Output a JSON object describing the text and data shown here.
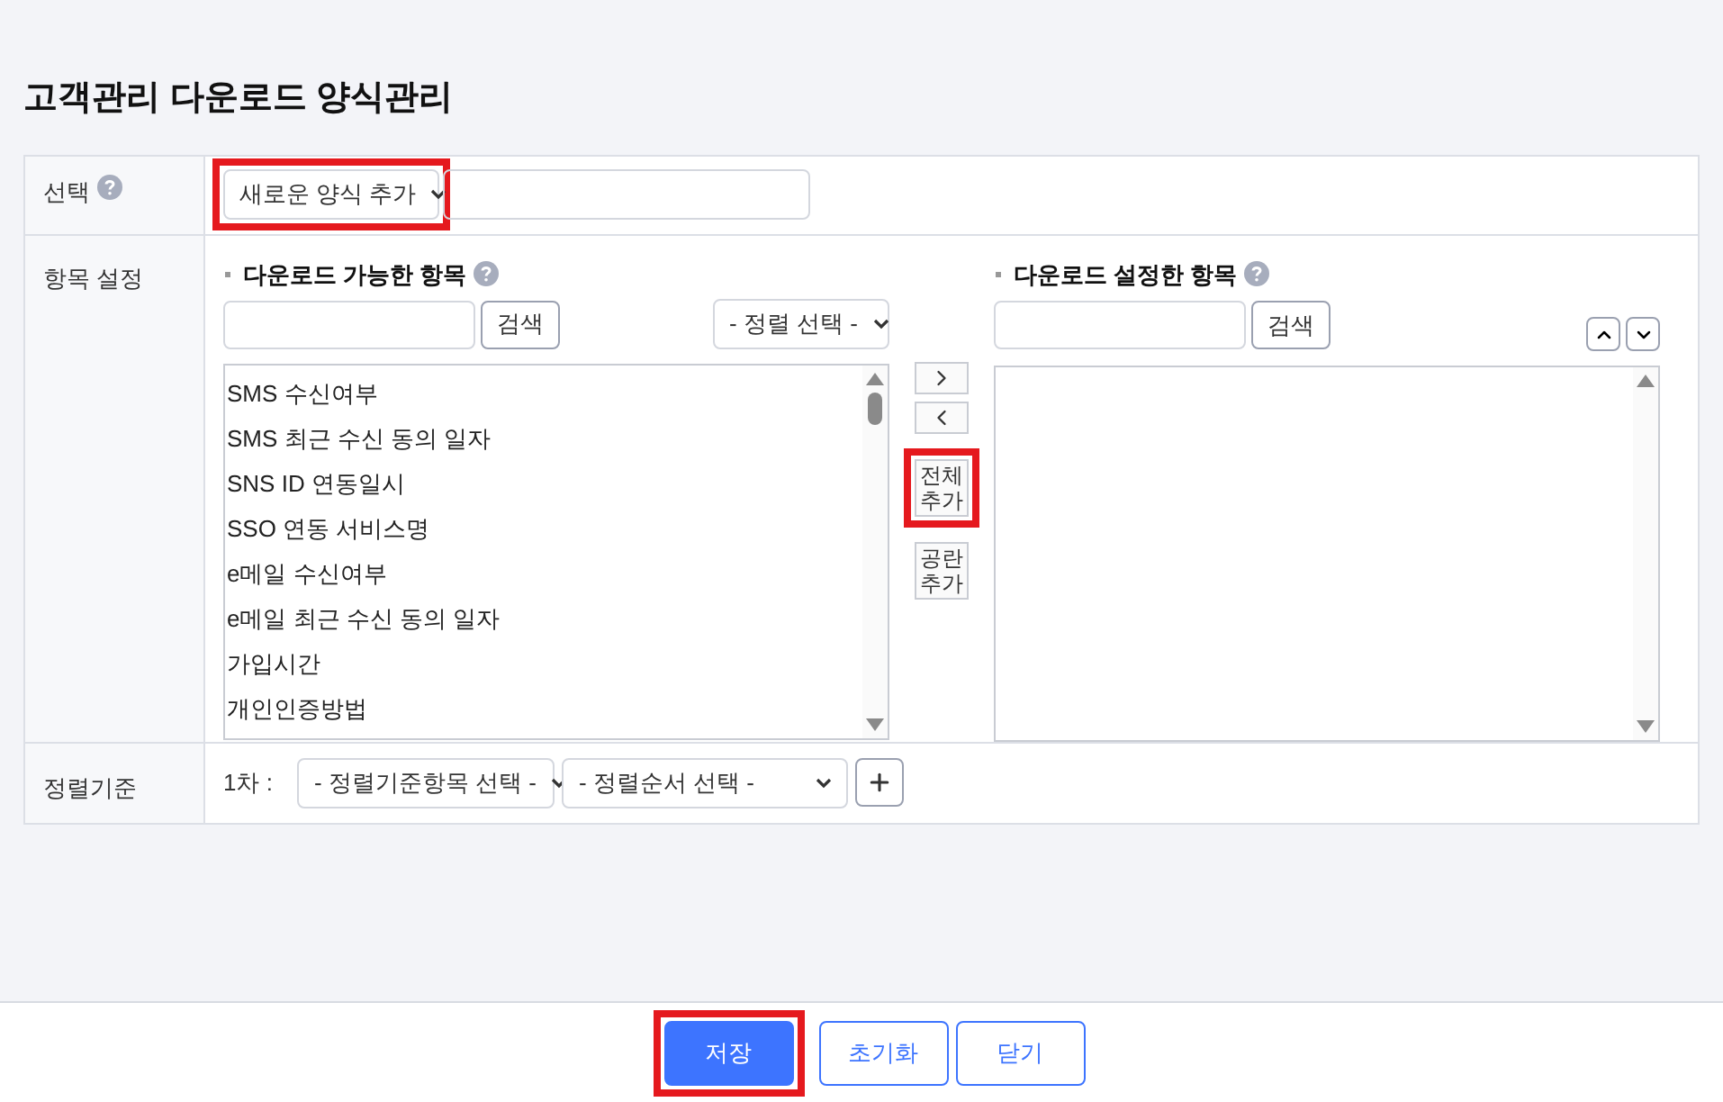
{
  "title": "고객관리 다운로드 양식관리",
  "select_row": {
    "label": "선택",
    "dropdown": {
      "value": "새로운 양식 추가",
      "highlighted": true
    }
  },
  "items_row": {
    "label": "항목 설정",
    "available": {
      "heading": "다운로드 가능한 항목",
      "search_button": "검색",
      "sort_dropdown": "- 정렬 선택 -",
      "items": [
        "SMS 수신여부",
        "SMS 최근 수신 동의 일자",
        "SNS ID 연동일시",
        "SSO 연동 서비스명",
        "e메일 수신여부",
        "e메일 최근 수신 동의 일자",
        "가입시간",
        "개인인증방법"
      ]
    },
    "transfer_buttons": [
      {
        "kind": "move_right",
        "highlighted": false
      },
      {
        "kind": "move_left",
        "highlighted": false
      },
      {
        "kind": "text",
        "lines": [
          "전체",
          "추가"
        ],
        "highlighted": true
      },
      {
        "kind": "text",
        "lines": [
          "공란",
          "추가"
        ],
        "highlighted": false
      }
    ],
    "chosen": {
      "heading": "다운로드 설정한 항목",
      "search_button": "검색"
    }
  },
  "sort_row": {
    "label": "정렬기준",
    "order": "1차 :",
    "field_dropdown": "- 정렬기준항목 선택 -",
    "order_dropdown": "- 정렬순서 선택 -"
  },
  "footer_buttons": [
    {
      "label": "저장",
      "kind": "primary",
      "highlighted": true
    },
    {
      "label": "초기화",
      "kind": "outline",
      "highlighted": false
    },
    {
      "label": "닫기",
      "kind": "outline",
      "highlighted": false
    }
  ]
}
